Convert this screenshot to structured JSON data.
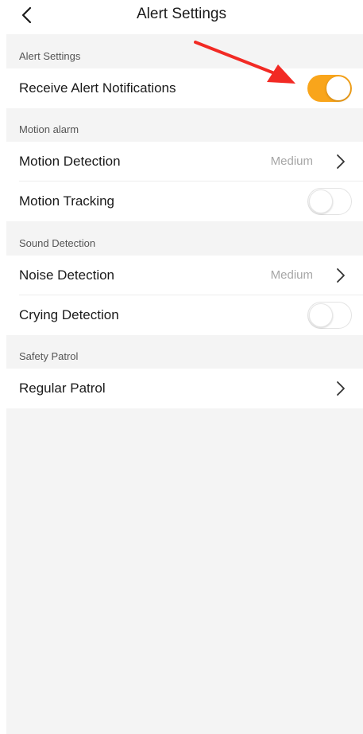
{
  "header": {
    "title": "Alert Settings"
  },
  "sections": {
    "alert": {
      "header": "Alert Settings",
      "receive_notifications": {
        "label": "Receive Alert Notifications",
        "enabled": true
      }
    },
    "motion": {
      "header": "Motion alarm",
      "motion_detection": {
        "label": "Motion Detection",
        "value": "Medium"
      },
      "motion_tracking": {
        "label": "Motion Tracking",
        "enabled": false
      }
    },
    "sound": {
      "header": "Sound Detection",
      "noise_detection": {
        "label": "Noise Detection",
        "value": "Medium"
      },
      "crying_detection": {
        "label": "Crying Detection",
        "enabled": false
      }
    },
    "safety": {
      "header": "Safety Patrol",
      "regular_patrol": {
        "label": "Regular Patrol"
      }
    }
  },
  "colors": {
    "accent": "#f9a51b",
    "annotation_arrow": "#f22a24",
    "background": "#f4f4f4"
  },
  "icons": {
    "back": "chevron-left-icon",
    "disclosure": "chevron-right-icon",
    "annotation": "red-arrow-icon"
  }
}
